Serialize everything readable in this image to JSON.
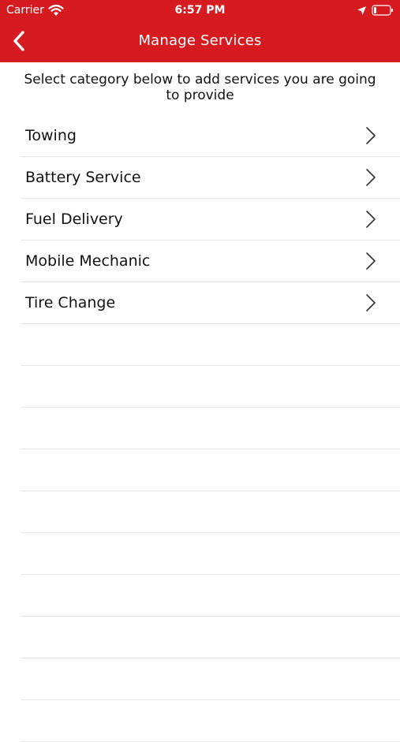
{
  "status_bar": {
    "carrier": "Carrier",
    "time": "6:57 PM"
  },
  "nav": {
    "title": "Manage Services",
    "back_icon": "chevron-left-icon"
  },
  "instructions": "Select category below to add services you are going to provide",
  "services": [
    {
      "label": "Towing"
    },
    {
      "label": "Battery Service"
    },
    {
      "label": "Fuel Delivery"
    },
    {
      "label": "Mobile Mechanic"
    },
    {
      "label": "Tire Change"
    }
  ],
  "colors": {
    "header": "#d51b20",
    "separator": "#e6e6e6",
    "text": "#111111"
  }
}
